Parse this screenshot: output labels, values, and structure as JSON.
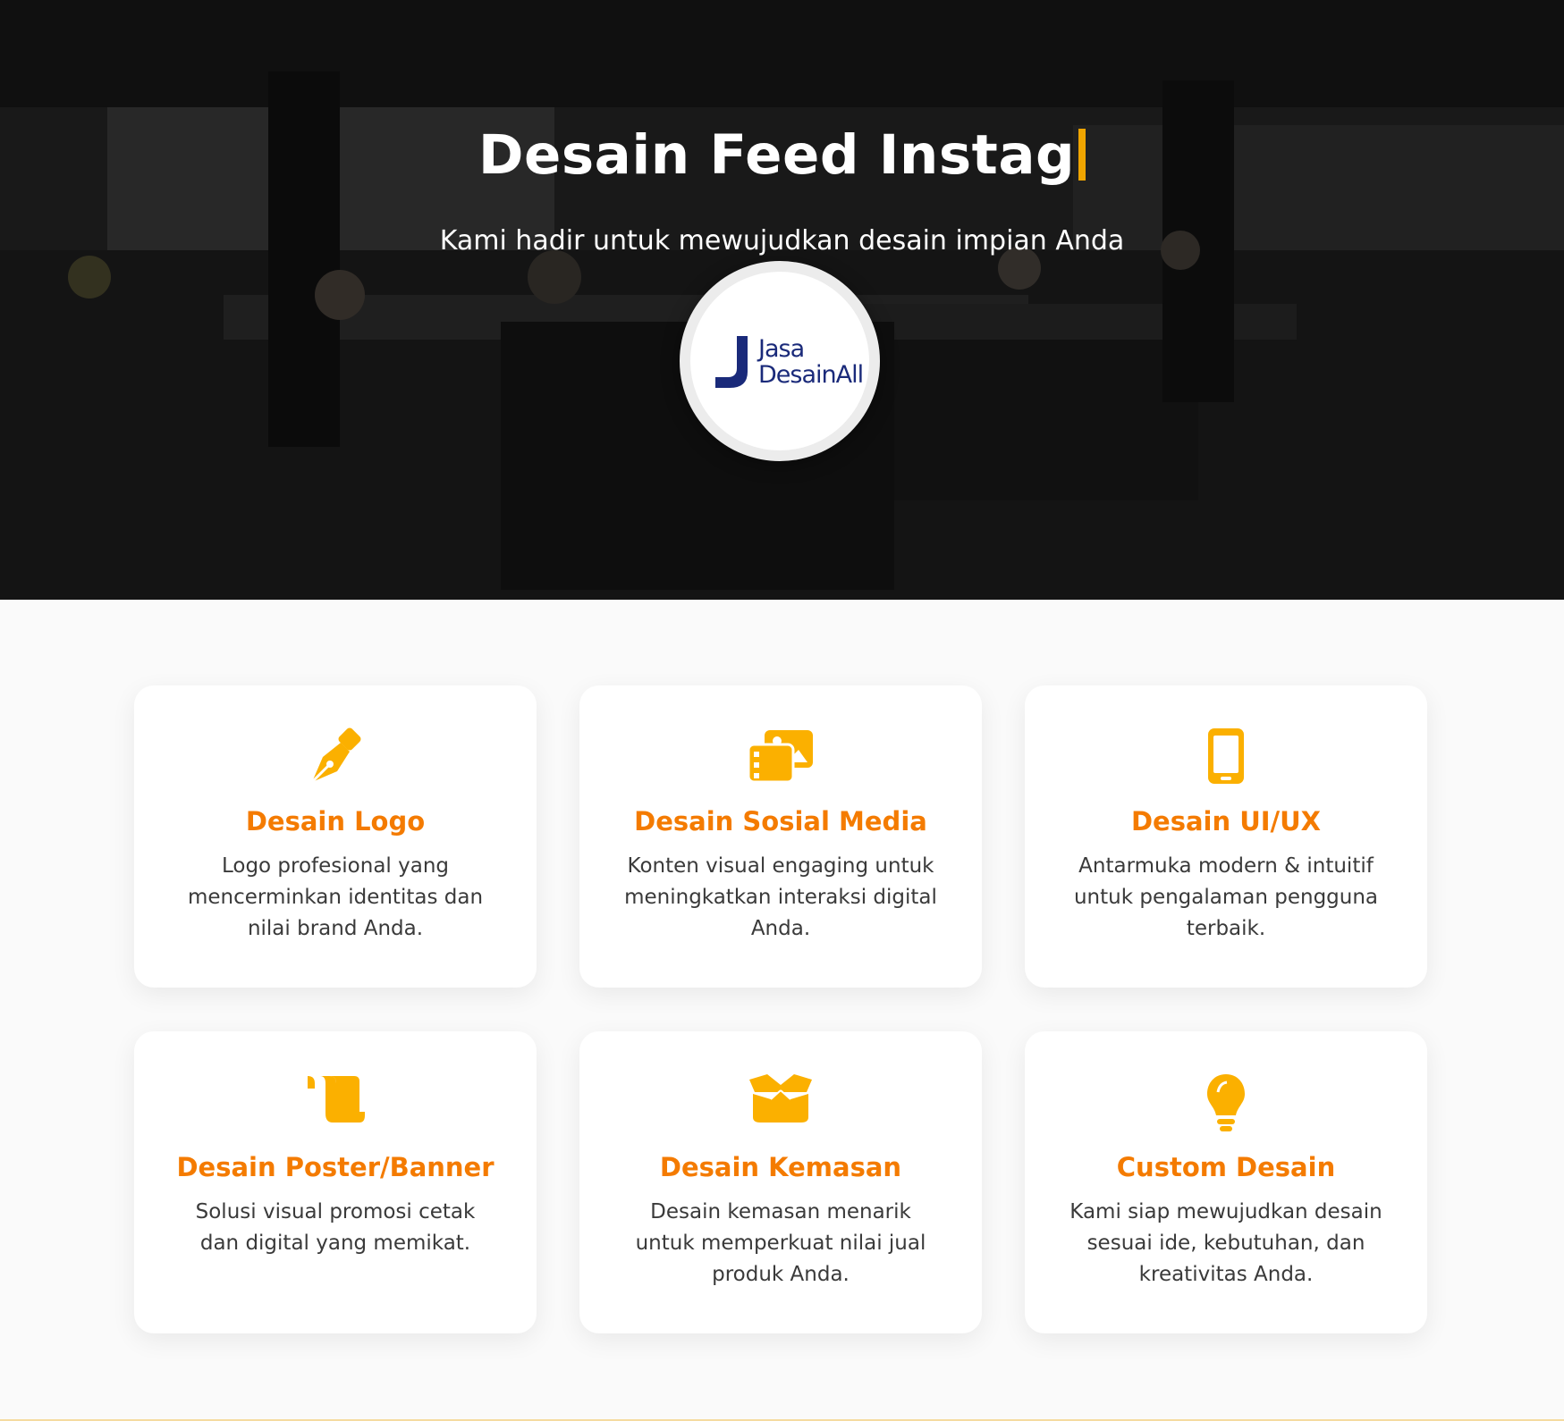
{
  "hero": {
    "title": "Desain Feed Instag",
    "subtitle": "Kami hadir untuk mewujudkan desain impian Anda",
    "logo": {
      "line1": "Jasa",
      "line2": "DesainAll",
      "mark": "J"
    },
    "cursor_color": "#f0a500"
  },
  "services": [
    {
      "icon": "pen-nib-icon",
      "title": "Desain Logo",
      "description": "Logo profesional yang mencerminkan identitas dan nilai brand Anda."
    },
    {
      "icon": "photo-gallery-icon",
      "title": "Desain Sosial Media",
      "description": "Konten visual engaging untuk meningkatkan interaksi digital Anda."
    },
    {
      "icon": "mobile-phone-icon",
      "title": "Desain UI/UX",
      "description": "Antarmuka modern & intuitif untuk pengalaman pengguna terbaik."
    },
    {
      "icon": "scroll-icon",
      "title": "Desain Poster/Banner",
      "description": "Solusi visual promosi cetak dan digital yang memikat."
    },
    {
      "icon": "open-box-icon",
      "title": "Desain Kemasan",
      "description": "Desain kemasan menarik untuk memperkuat nilai jual produk Anda."
    },
    {
      "icon": "lightbulb-icon",
      "title": "Custom Desain",
      "description": "Kami siap mewujudkan desain sesuai ide, kebutuhan, dan kreativitas Anda."
    }
  ],
  "colors": {
    "accent": "#f47b00",
    "icon": "#fbb000",
    "brand_navy": "#1a2a7a"
  }
}
